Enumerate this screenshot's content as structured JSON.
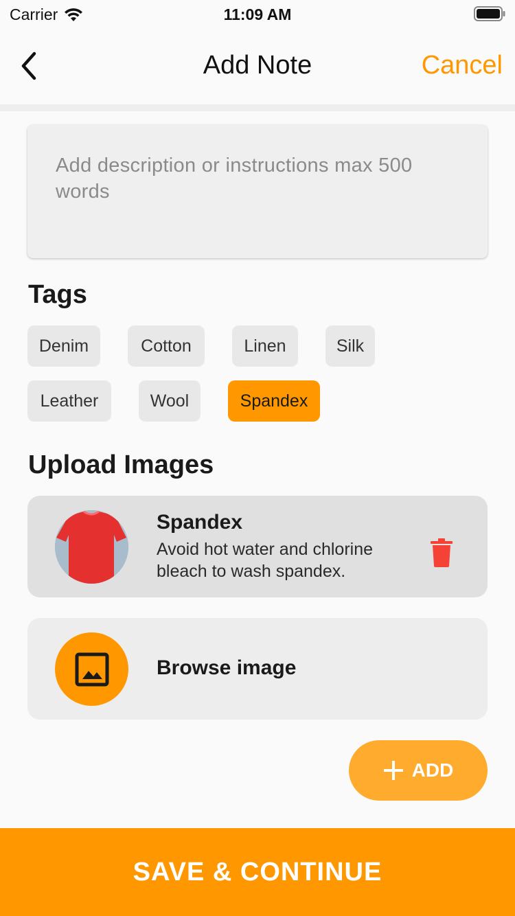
{
  "status_bar": {
    "carrier": "Carrier",
    "time": "11:09 AM"
  },
  "nav": {
    "title": "Add Note",
    "cancel_label": "Cancel"
  },
  "description": {
    "placeholder": "Add description or instructions max 500 words"
  },
  "tags": {
    "title": "Tags",
    "items": [
      {
        "label": "Denim",
        "selected": false
      },
      {
        "label": "Cotton",
        "selected": false
      },
      {
        "label": "Linen",
        "selected": false
      },
      {
        "label": "Silk",
        "selected": false
      },
      {
        "label": "Leather",
        "selected": false
      },
      {
        "label": "Wool",
        "selected": false
      },
      {
        "label": "Spandex",
        "selected": true
      }
    ]
  },
  "upload": {
    "title": "Upload Images",
    "uploaded": {
      "title": "Spandex",
      "description": "Avoid hot water and chlorine bleach to wash spandex."
    },
    "browse_label": "Browse image",
    "add_label": "ADD"
  },
  "save_label": "SAVE & CONTINUE",
  "colors": {
    "accent": "#ff9800",
    "delete": "#f44336"
  }
}
